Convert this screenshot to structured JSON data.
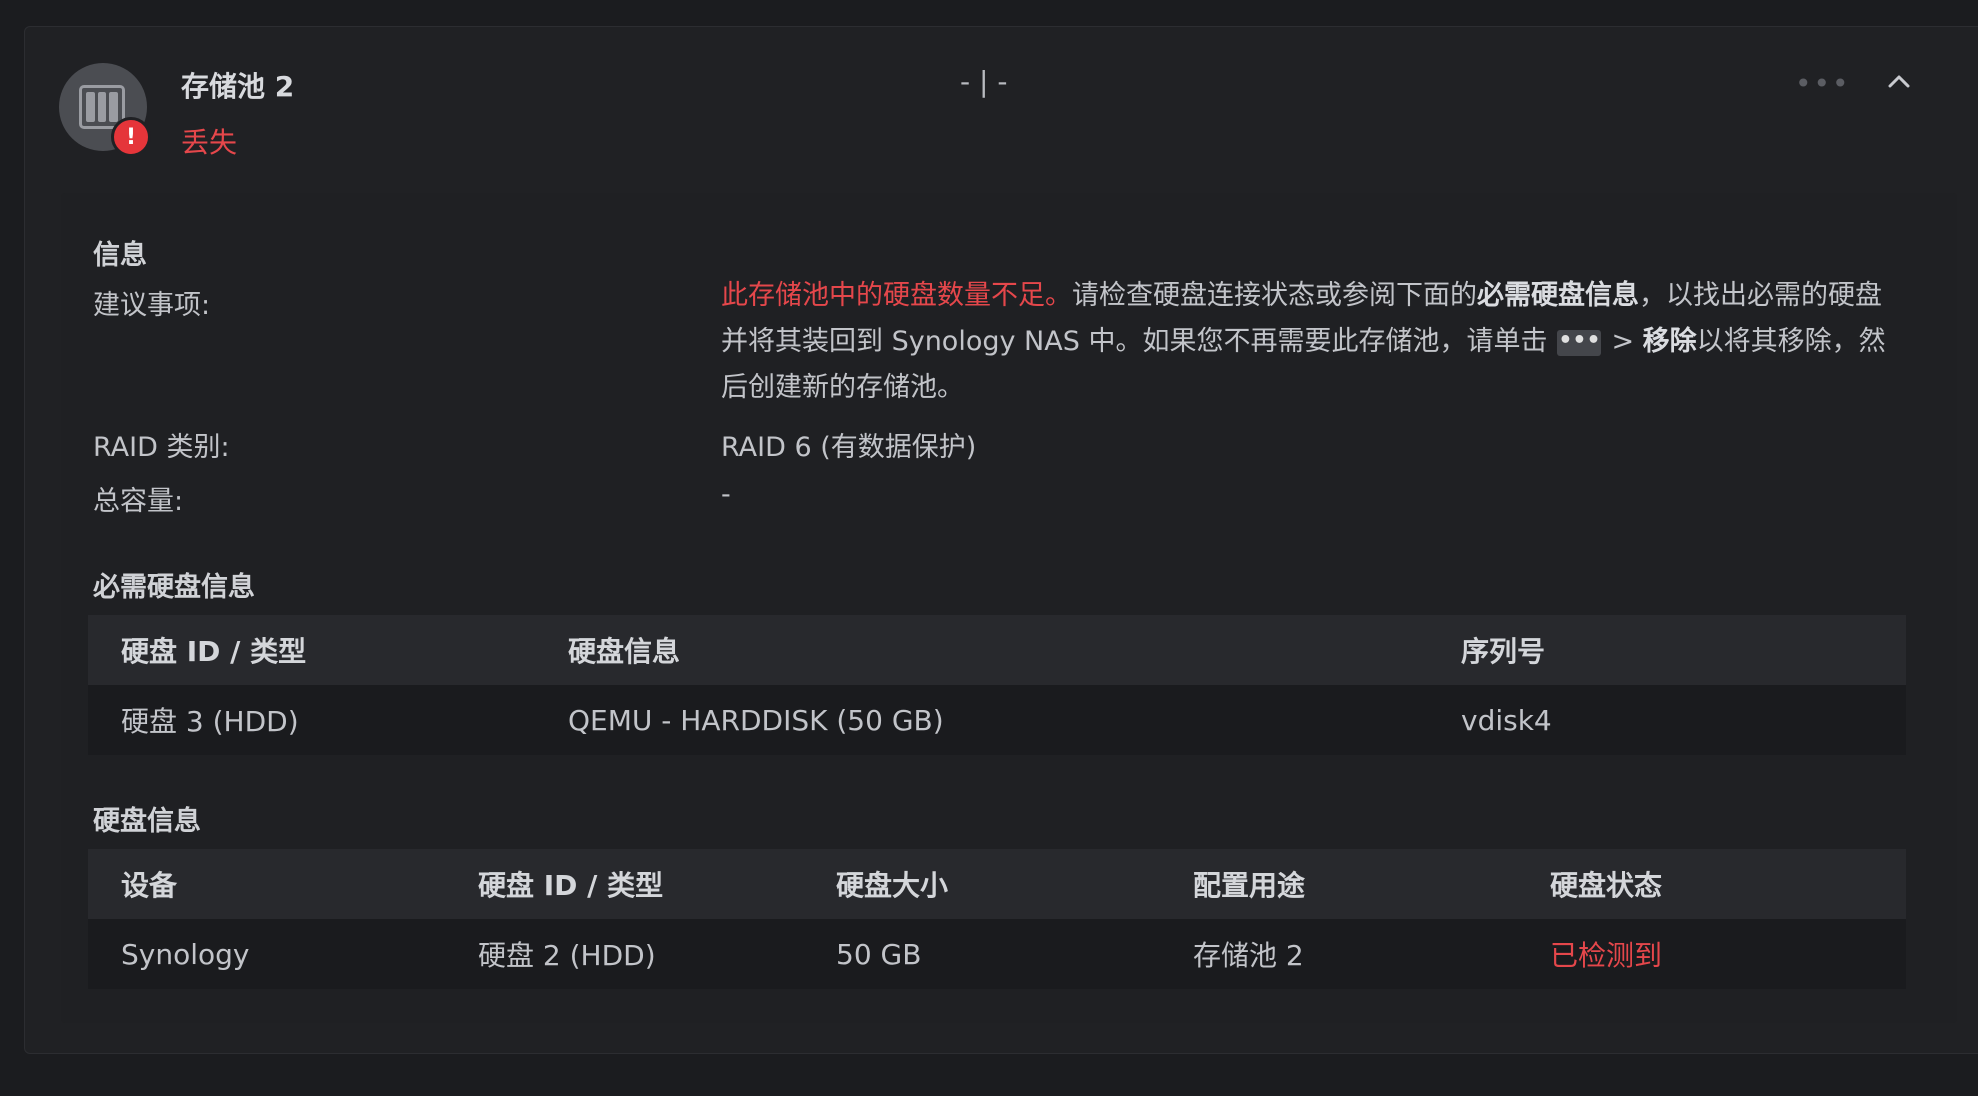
{
  "pool": {
    "title": "存储池 2",
    "status": "丢失",
    "usage": "- | -"
  },
  "info": {
    "section_title": "信息",
    "advice_label": "建议事项:",
    "advice_warning": "此存储池中的硬盘数量不足。",
    "advice_text_1": "请检查硬盘连接状态或参阅下面的",
    "advice_bold_1": "必需硬盘信息",
    "advice_text_2": "，以找出必需的硬盘并将其装回到 Synology NAS 中。如果您不再需要此存储池，请单击",
    "advice_dots": "•••",
    "advice_arrow": ">",
    "advice_bold_2": "移除",
    "advice_text_3": "以将其移除，然后创建新的存储池。",
    "raid_label": "RAID 类别:",
    "raid_value": "RAID 6 (有数据保护)",
    "capacity_label": "总容量:",
    "capacity_value": "-"
  },
  "required_disks": {
    "section_title": "必需硬盘信息",
    "headers": [
      "硬盘 ID / 类型",
      "硬盘信息",
      "序列号"
    ],
    "rows": [
      [
        "硬盘 3 (HDD)",
        "QEMU - HARDDISK (50 GB)",
        "vdisk4"
      ]
    ]
  },
  "disk_info": {
    "section_title": "硬盘信息",
    "headers": [
      "设备",
      "硬盘 ID / 类型",
      "硬盘大小",
      "配置用途",
      "硬盘状态"
    ],
    "rows": [
      [
        "Synology",
        "硬盘 2 (HDD)",
        "50 GB",
        "存储池 2",
        "已检测到"
      ]
    ]
  },
  "icons": {
    "pool": "nas-device-icon",
    "alert": "exclamation-icon",
    "more": "more-dots-icon",
    "collapse": "chevron-up-icon"
  },
  "colors": {
    "error": "#e5474b",
    "background": "#202124"
  }
}
